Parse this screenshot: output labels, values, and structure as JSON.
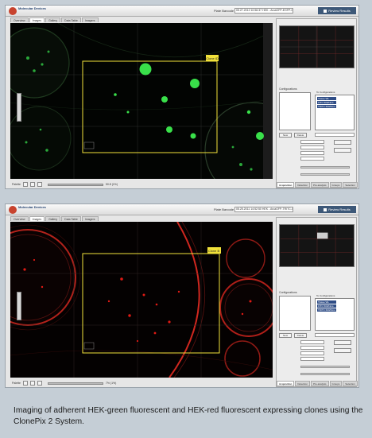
{
  "screens": [
    {
      "app_name": "Molecular Devices",
      "plate_label": "Plate Barcode",
      "plate_value": "05.27.2012 10:56:37 HEK - ArcaGFP-EGFP-000-1003",
      "review_button": "Review Results",
      "tabs": [
        "Overview",
        "Images",
        "Gallery",
        "Data Table",
        "Imagers"
      ],
      "active_tab": "Images",
      "roi_label": "Clone ID",
      "palette_label": "Palette",
      "zoom_value": "50.8 (1%)",
      "fluorescence": "green",
      "configs_title": "Configurations",
      "config_list_header": "To Configurations",
      "config_items": [
        "Tissue WL",
        "FITC 500/Nms",
        "TRITC 600/Nms"
      ],
      "new_button": "New",
      "delete_button": "Delete",
      "panel_tabs": [
        "Acquisition",
        "Detection",
        "Pre-analysis",
        "Groups",
        "Selection"
      ],
      "active_panel_tab": "Acquisition"
    },
    {
      "app_name": "Molecular Devices",
      "plate_label": "Plate Barcode",
      "plate_value": "05.25.2011 14:52:50 HEK - ArcaGFP-TRITC-000-1003",
      "review_button": "Review Results",
      "tabs": [
        "Overview",
        "Images",
        "Gallery",
        "Data Table",
        "Imagers"
      ],
      "active_tab": "Images",
      "roi_label": "Clone B",
      "palette_label": "Palette",
      "zoom_value": "7% (1%)",
      "fluorescence": "red",
      "configs_title": "Configurations",
      "config_list_header": "To Configurations",
      "config_items": [
        "Tissue WL",
        "FITC 500/Nms",
        "TRITC 600/Nms"
      ],
      "new_button": "New",
      "delete_button": "Delete",
      "panel_tabs": [
        "Acquisition",
        "Detection",
        "Pre-analysis",
        "Groups",
        "Selection"
      ],
      "active_panel_tab": "Acquisition"
    }
  ],
  "caption": "Imaging of adherent HEK-green fluorescent and HEK-red fluorescent expressing clones using the ClonePix 2 System.",
  "colors": {
    "green": "#39e04a",
    "red": "#e01a14",
    "roi": "#f2e23a"
  }
}
